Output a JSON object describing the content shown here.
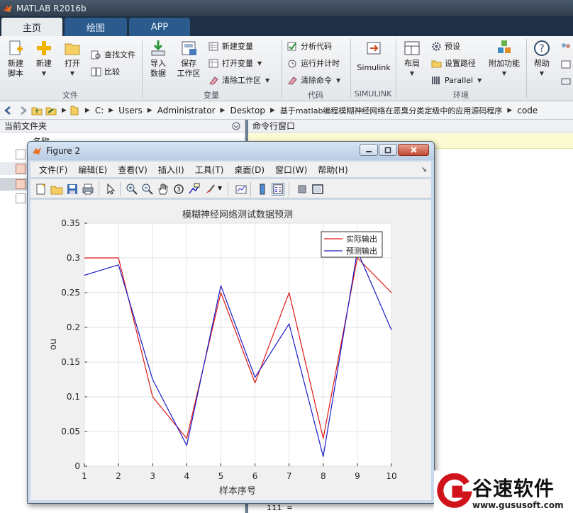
{
  "window": {
    "title": "MATLAB R2016b"
  },
  "tabs": [
    {
      "label": "主页",
      "active": true
    },
    {
      "label": "绘图",
      "active": false
    },
    {
      "label": "APP",
      "active": false
    }
  ],
  "ribbon": {
    "file": {
      "group_label": "文件",
      "new_script": [
        "新建",
        "脚本"
      ],
      "new": "新建",
      "open": "打开",
      "find_files": "查找文件",
      "compare": "比较"
    },
    "variable": {
      "group_label": "变量",
      "import_data": [
        "导入",
        "数据"
      ],
      "save_workspace": [
        "保存",
        "工作区"
      ],
      "new_variable": "新建变量",
      "open_variable": "打开变量",
      "clear_workspace": "清除工作区"
    },
    "code": {
      "group_label": "代码",
      "analyze_code": "分析代码",
      "run_and_time": "运行并计时",
      "clear_commands": "清除命令"
    },
    "simulink": {
      "group_label": "SIMULINK",
      "simulink": "Simulink"
    },
    "environment": {
      "group_label": "环境",
      "layout": "布局",
      "preferences": "预设",
      "set_path": "设置路径",
      "parallel": "Parallel",
      "addons": "附加功能"
    },
    "resources": {
      "help": "帮助"
    }
  },
  "address": {
    "crumbs": [
      "C:",
      "Users",
      "Administrator",
      "Desktop",
      "基于matlab编程模糊神经网络在恶臭分类定级中的应用源码程序",
      "code"
    ]
  },
  "panels": {
    "current_folder": "当前文件夹",
    "command_window": "命令行窗口",
    "partial_name_header": "名称",
    "command_tail": "iii ="
  },
  "figure": {
    "title": "Figure 2",
    "menu": [
      "文件(F)",
      "编辑(E)",
      "查看(V)",
      "插入(I)",
      "工具(T)",
      "桌面(D)",
      "窗口(W)",
      "帮助(H)"
    ]
  },
  "chart_data": {
    "type": "line",
    "title": "模糊神经网络测试数据预测",
    "xlabel": "样本序号",
    "ylabel": "ou",
    "x": [
      1,
      2,
      3,
      4,
      5,
      6,
      7,
      8,
      9,
      10
    ],
    "xlim": [
      1,
      10
    ],
    "ylim": [
      0,
      0.35
    ],
    "xticks": [
      "1",
      "2",
      "3",
      "4",
      "5",
      "6",
      "7",
      "8",
      "9",
      "10"
    ],
    "yticks": [
      "0",
      "0.05",
      "0.1",
      "0.15",
      "0.2",
      "0.25",
      "0.3",
      "0.35"
    ],
    "grid": true,
    "legend_position": "top-right",
    "series": [
      {
        "name": "实际输出",
        "color": "#e01818",
        "values": [
          0.3,
          0.3,
          0.1,
          0.04,
          0.25,
          0.12,
          0.25,
          0.04,
          0.3,
          0.25
        ]
      },
      {
        "name": "预测输出",
        "color": "#1a1ac8",
        "values": [
          0.275,
          0.29,
          0.125,
          0.03,
          0.26,
          0.128,
          0.205,
          0.014,
          0.31,
          0.196
        ]
      }
    ]
  },
  "watermark": {
    "brand": "谷速软件",
    "url": "www.gususoft.com"
  }
}
